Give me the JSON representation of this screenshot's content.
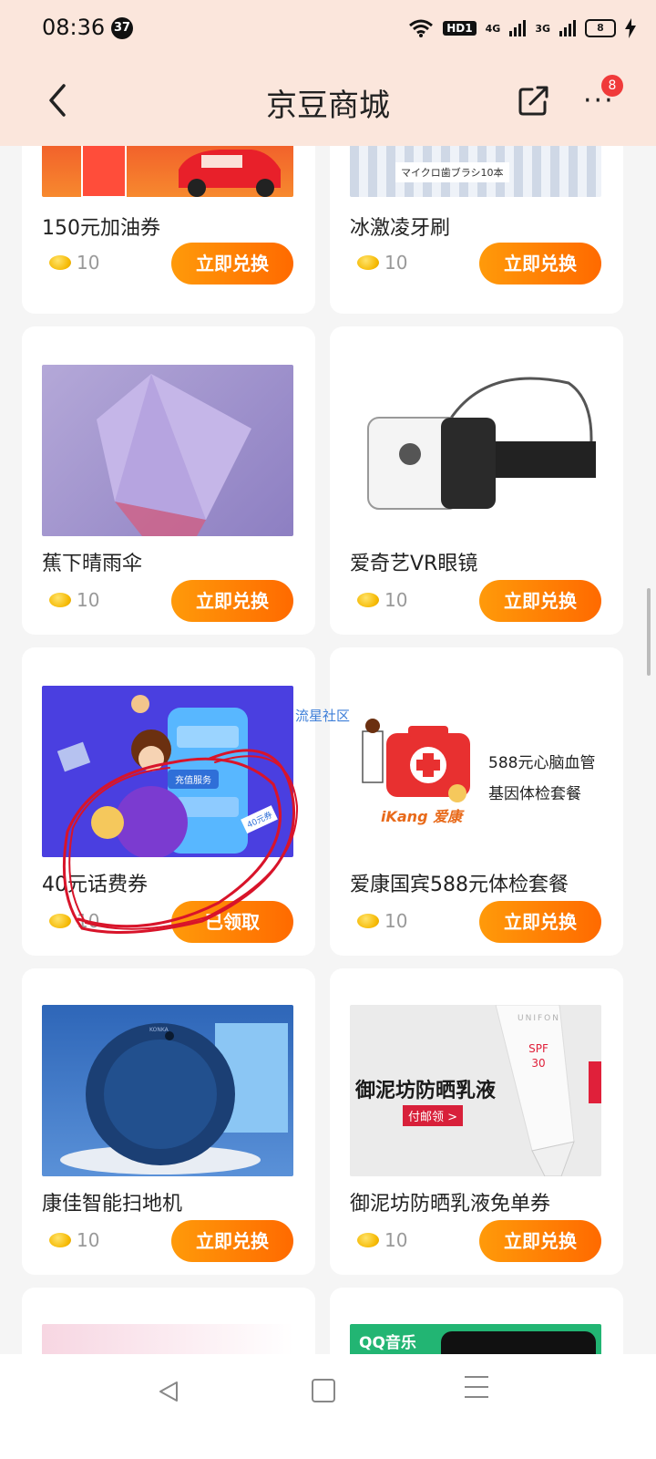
{
  "status_bar": {
    "time": "08:36",
    "notification_count": "37",
    "hd": "HD1",
    "net1": "4G",
    "net2": "3G",
    "battery": "8"
  },
  "header": {
    "title": "京豆商城",
    "menu_badge": "8"
  },
  "watermark": "流星社区",
  "products": [
    {
      "name": "150元加油券",
      "beans": "10",
      "button": "立即兑换"
    },
    {
      "name": "冰激凌牙刷",
      "beans": "10",
      "button": "立即兑换"
    },
    {
      "name": "蕉下晴雨伞",
      "beans": "10",
      "button": "立即兑换"
    },
    {
      "name": "爱奇艺VR眼镜",
      "beans": "10",
      "button": "立即兑换"
    },
    {
      "name": "40元话费券",
      "beans": "10",
      "button": "已领取"
    },
    {
      "name": "爱康国宾588元体检套餐",
      "beans": "10",
      "button": "立即兑换"
    },
    {
      "name": "康佳智能扫地机",
      "beans": "10",
      "button": "立即兑换"
    },
    {
      "name": "御泥坊防晒乳液免单券",
      "beans": "10",
      "button": "立即兑换"
    }
  ],
  "image_texts": {
    "toothbrush": "マイクロ歯ブラシ10本",
    "phone_service": "充值服务",
    "coupon_40": "40元券",
    "ikang_l1": "588元心脑血管",
    "ikang_l2": "基因体检套餐",
    "ikang_brand": "iKang 爱康",
    "sunscreen_title": "御泥坊防晒乳液",
    "sunscreen_cta": "付邮领 >",
    "sunscreen_spf": "SPF 30",
    "brand_unifon": "UNIFON",
    "brand_konka": "KONKA",
    "qq_music": "QQ音乐"
  },
  "colors": {
    "header_bg": "#fbe6dc",
    "button_orange": "#ff7a00",
    "annotation_red": "#d8142a"
  }
}
